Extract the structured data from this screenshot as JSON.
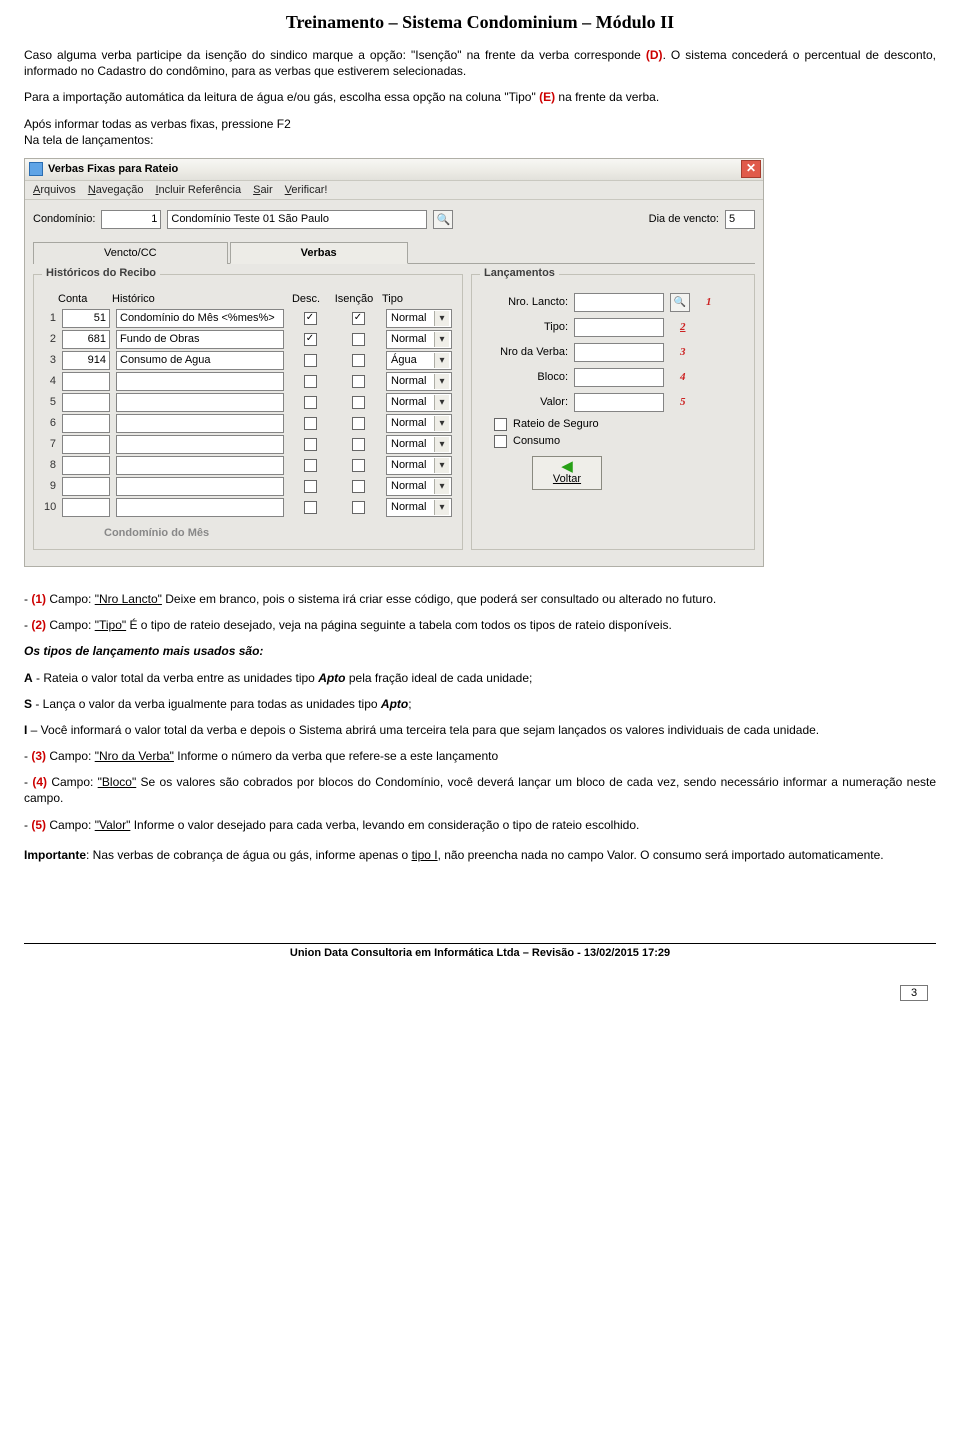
{
  "doc_title": "Treinamento – Sistema Condominium – Módulo II",
  "intro": {
    "p1a": "Caso alguma verba participe da isenção do sindico marque a opção: \"Isenção\" na frente da verba corresponde ",
    "p1d": "(D)",
    "p1b": ". O sistema concederá o percentual de desconto, informado no Cadastro do condômino, para as verbas que estiverem selecionadas.",
    "p2a": "Para a importação automática da leitura de água e/ou gás, escolha essa opção na coluna \"Tipo\" ",
    "p2e": "(E)",
    "p2b": " na frente da verba.",
    "p3": "Após informar todas as verbas fixas, pressione F2",
    "p4": "Na tela de lançamentos:"
  },
  "window": {
    "title": "Verbas Fixas para Rateio",
    "menu": {
      "arquivos": "Arquivos",
      "navegacao": "Navegação",
      "incluir": "Incluir Referência",
      "sair": "Sair",
      "verificar": "Verificar!"
    },
    "condominio_lbl": "Condomínio:",
    "condominio_num": "1",
    "condominio_nome": "Condomínio Teste 01 São Paulo",
    "dia_vencto_lbl": "Dia de vencto:",
    "dia_vencto_val": "5",
    "tab_left": "Vencto/CC",
    "tab_right": "Verbas"
  },
  "left_fs": {
    "legend": "Históricos do Recibo",
    "hdr": {
      "conta": "Conta",
      "historico": "Histórico",
      "desc": "Desc.",
      "isencao": "Isenção",
      "tipo": "Tipo"
    },
    "rows": [
      {
        "n": "1",
        "conta": "51",
        "hist": "Condomínio do Mês <%mes%>",
        "desc": true,
        "isen": true,
        "tipo": "Normal"
      },
      {
        "n": "2",
        "conta": "681",
        "hist": "Fundo de Obras",
        "desc": true,
        "isen": false,
        "tipo": "Normal"
      },
      {
        "n": "3",
        "conta": "914",
        "hist": "Consumo de Agua",
        "desc": false,
        "isen": false,
        "tipo": "Água"
      },
      {
        "n": "4",
        "conta": "",
        "hist": "",
        "desc": false,
        "isen": false,
        "tipo": "Normal"
      },
      {
        "n": "5",
        "conta": "",
        "hist": "",
        "desc": false,
        "isen": false,
        "tipo": "Normal"
      },
      {
        "n": "6",
        "conta": "",
        "hist": "",
        "desc": false,
        "isen": false,
        "tipo": "Normal"
      },
      {
        "n": "7",
        "conta": "",
        "hist": "",
        "desc": false,
        "isen": false,
        "tipo": "Normal"
      },
      {
        "n": "8",
        "conta": "",
        "hist": "",
        "desc": false,
        "isen": false,
        "tipo": "Normal"
      },
      {
        "n": "9",
        "conta": "",
        "hist": "",
        "desc": false,
        "isen": false,
        "tipo": "Normal"
      },
      {
        "n": "10",
        "conta": "",
        "hist": "",
        "desc": false,
        "isen": false,
        "tipo": "Normal"
      }
    ],
    "foot": "Condomínio do Mês"
  },
  "right_fs": {
    "legend": "Lançamentos",
    "nro_lancto_lbl": "Nro. Lancto:",
    "tipo_lbl": "Tipo:",
    "nro_verba_lbl": "Nro da Verba:",
    "bloco_lbl": "Bloco:",
    "valor_lbl": "Valor:",
    "ann1": "1",
    "ann2": "2",
    "ann3": "3",
    "ann4": "4",
    "ann5": "5",
    "chk_rateio": "Rateio de Seguro",
    "chk_consumo": "Consumo",
    "btn_voltar": "Voltar"
  },
  "explain": {
    "e1a": "- ",
    "e1n": "(1)",
    "e1b": " Campo: ",
    "e1u": "\"Nro Lancto\"",
    "e1c": " Deixe em branco, pois o sistema irá criar esse código, que poderá ser consultado ou alterado no futuro.",
    "e2a": "- ",
    "e2n": "(2)",
    "e2b": " Campo: ",
    "e2u": "\"Tipo\"",
    "e2c": " É o tipo de rateio desejado, veja na página seguinte a tabela com todos os tipos de rateio disponíveis.",
    "head_usados": "Os tipos de lançamento mais usados são:",
    "la": "A",
    "la_txt": " - Rateia o valor total da verba entre as unidades tipo ",
    "la_apto": "Apto",
    "la_tail": " pela fração ideal de cada unidade;",
    "ls": "S",
    "ls_txt": " - Lança o valor da verba igualmente para todas as unidades tipo ",
    "ls_apto": "Apto",
    "ls_tail": ";",
    "li": "I",
    "li_txt": " – Você informará o valor total da verba e depois o Sistema abrirá uma terceira tela para que sejam lançados os valores individuais de cada unidade.",
    "e3a": "- ",
    "e3n": "(3)",
    "e3b": " Campo: ",
    "e3u": "\"Nro da Verba\"",
    "e3c": " Informe o número da verba que refere-se a este lançamento",
    "e4a": "- ",
    "e4n": "(4)",
    "e4b": " Campo: ",
    "e4u": "\"Bloco\"",
    "e4c": " Se os valores são cobrados por blocos do Condomínio, você deverá lançar um bloco de cada vez, sendo necessário informar a numeração neste campo.",
    "e5a": "- ",
    "e5n": "(5)",
    "e5b": " Campo: ",
    "e5u": "\"Valor\"",
    "e5c": " Informe o valor desejado para cada verba, levando em consideração o tipo de rateio escolhido.",
    "imp_lbl": "Importante",
    "imp_txt": ": Nas verbas de cobrança de água ou gás, informe apenas o ",
    "imp_u": "tipo I",
    "imp_tail": ", não preencha nada no campo Valor. O consumo será importado automaticamente."
  },
  "footer": "Union Data Consultoria em Informática Ltda – Revisão - 13/02/2015 17:29",
  "page_number": "3"
}
